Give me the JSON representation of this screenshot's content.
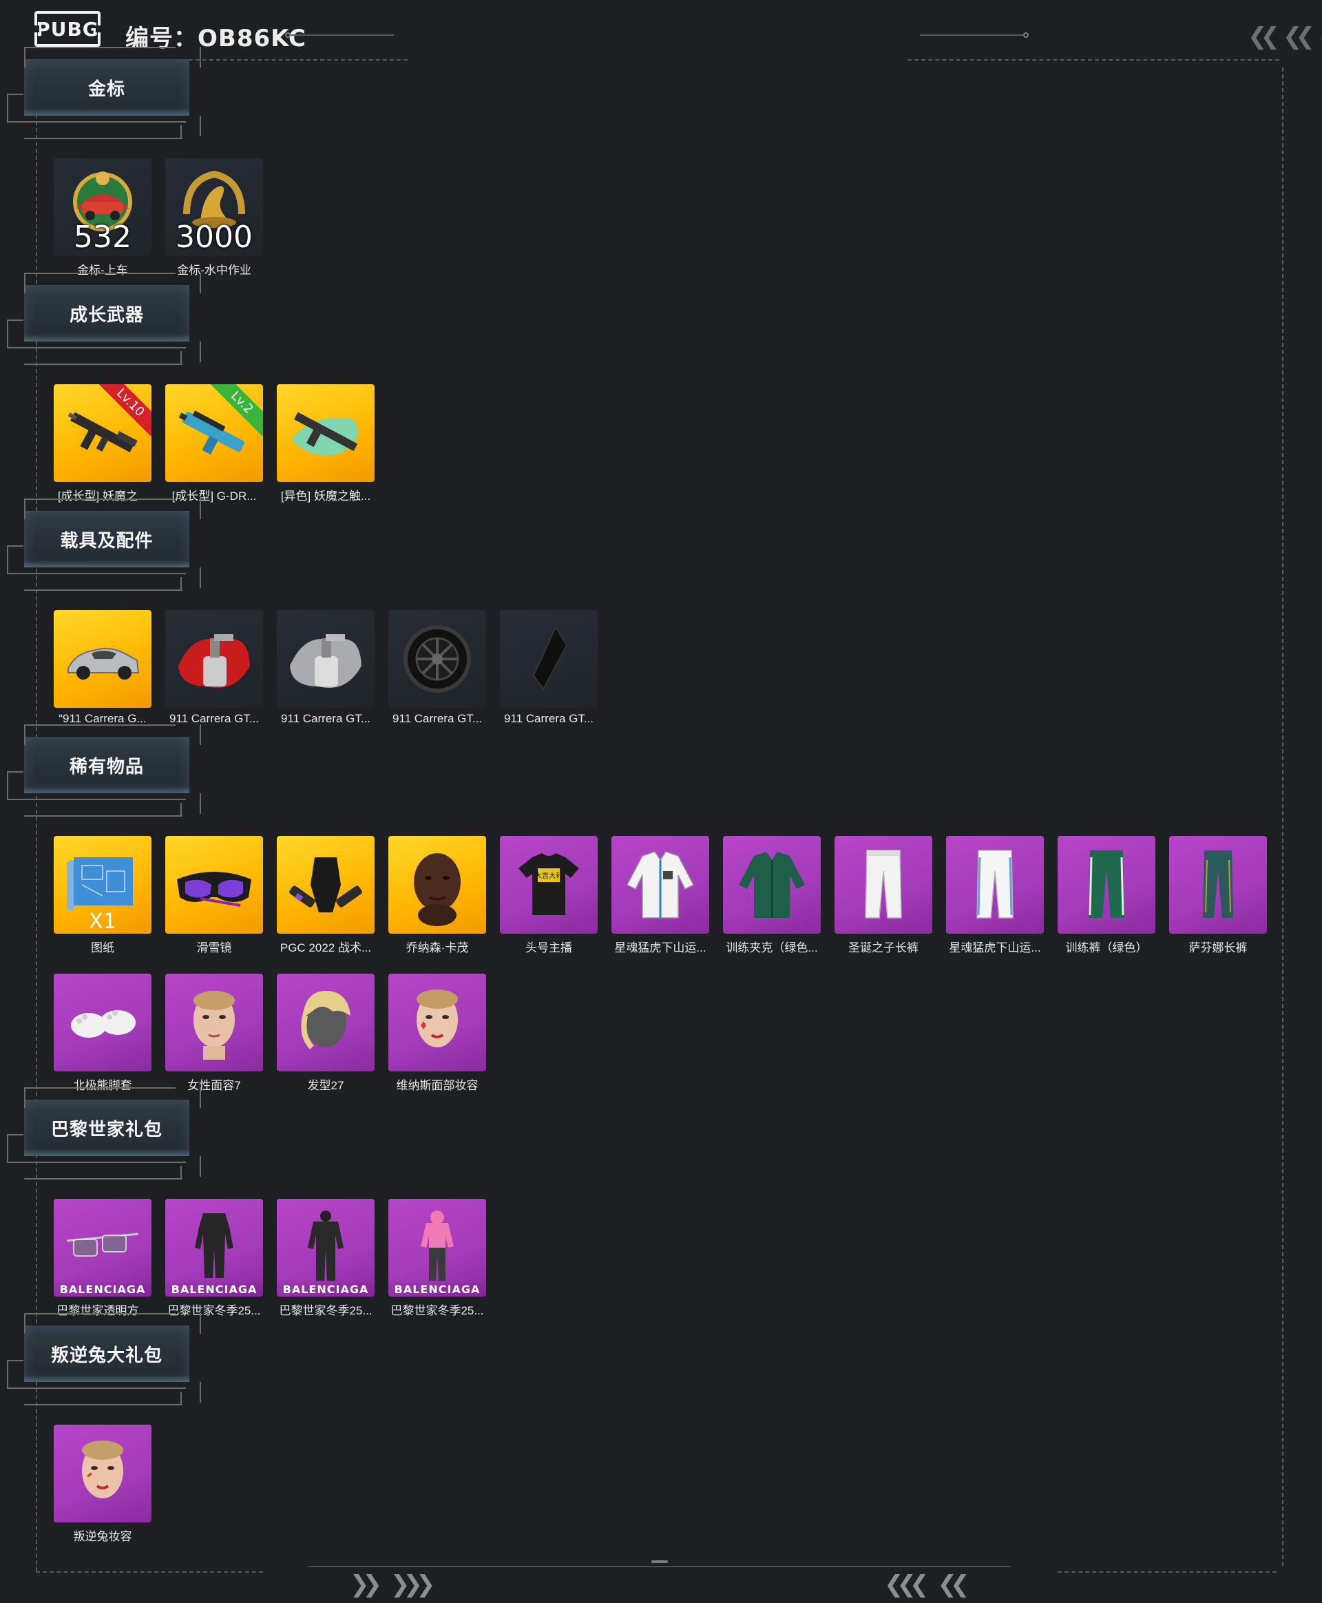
{
  "header": {
    "logo_text": "PUBG",
    "serial_label": "编号：",
    "serial_value": "OB86KC"
  },
  "sections": [
    {
      "title": "金标",
      "items": [
        {
          "label": "金标-上车",
          "tile": "dark",
          "icon": "gold-car-emblem-icon",
          "quantity": "532"
        },
        {
          "label": "金标-水中作业",
          "tile": "dark",
          "icon": "gold-seal-emblem-icon",
          "quantity": "3000"
        }
      ]
    },
    {
      "title": "成长武器",
      "items": [
        {
          "label": "[成长型] 妖魔之...",
          "tile": "gold",
          "icon": "assault-rifle-icon",
          "ribbon": "Lv.10",
          "ribbon_color": "#d82027"
        },
        {
          "label": "[成长型] G-DR...",
          "tile": "gold",
          "icon": "blue-rifle-icon",
          "ribbon": "Lv.2",
          "ribbon_color": "#39b53a"
        },
        {
          "label": "[异色] 妖魔之触...",
          "tile": "gold",
          "icon": "rifle-splash-icon"
        }
      ]
    },
    {
      "title": "载具及配件",
      "items": [
        {
          "label": "“911 Carrera G...",
          "tile": "gold",
          "icon": "sports-car-icon"
        },
        {
          "label": "911 Carrera GT...",
          "tile": "dark",
          "icon": "red-paint-spray-icon"
        },
        {
          "label": "911 Carrera GT...",
          "tile": "dark",
          "icon": "silver-paint-spray-icon"
        },
        {
          "label": "911 Carrera GT...",
          "tile": "dark",
          "icon": "wheel-rim-icon"
        },
        {
          "label": "911 Carrera GT...",
          "tile": "dark",
          "icon": "black-shard-icon"
        }
      ]
    },
    {
      "title": "稀有物品",
      "items": [
        {
          "label": "图纸",
          "tile": "gold",
          "icon": "blueprint-icon",
          "quantity_small": "X1"
        },
        {
          "label": "滑雪镜",
          "tile": "gold",
          "icon": "ski-goggles-icon"
        },
        {
          "label": "PGC 2022 战术...",
          "tile": "gold",
          "icon": "tactical-gear-icon"
        },
        {
          "label": "乔纳森·卡茂",
          "tile": "gold",
          "icon": "male-head-icon"
        },
        {
          "label": "头号主播",
          "tile": "purple",
          "icon": "tshirt-icon"
        },
        {
          "label": "星魂猛虎下山运...",
          "tile": "purple",
          "icon": "white-jacket-icon"
        },
        {
          "label": "训练夹克（绿色...",
          "tile": "purple",
          "icon": "green-jacket-icon"
        },
        {
          "label": "圣诞之子长裤",
          "tile": "purple",
          "icon": "white-pants-icon"
        },
        {
          "label": "星魂猛虎下山运...",
          "tile": "purple",
          "icon": "white-track-pants-icon"
        },
        {
          "label": "训练裤（绿色）",
          "tile": "purple",
          "icon": "green-pants-icon"
        },
        {
          "label": "萨芬娜长裤",
          "tile": "purple",
          "icon": "teal-pants-icon"
        }
      ],
      "items_row2": [
        {
          "label": "北极熊脚套",
          "tile": "purple",
          "icon": "bear-paws-icon"
        },
        {
          "label": "女性面容7",
          "tile": "purple",
          "icon": "female-face-icon"
        },
        {
          "label": "发型27",
          "tile": "purple",
          "icon": "hairstyle-icon"
        },
        {
          "label": "维纳斯面部妆容",
          "tile": "purple",
          "icon": "makeup-face-icon"
        }
      ]
    },
    {
      "title": "巴黎世家礼包",
      "items": [
        {
          "label": "巴黎世家透明方...",
          "tile": "purple",
          "icon": "sunglasses-icon",
          "badge": "BALENCIAGA"
        },
        {
          "label": "巴黎世家冬季25...",
          "tile": "purple",
          "icon": "black-outfit-icon",
          "badge": "BALENCIAGA"
        },
        {
          "label": "巴黎世家冬季25...",
          "tile": "purple",
          "icon": "black-suit-icon",
          "badge": "BALENCIAGA"
        },
        {
          "label": "巴黎世家冬季25...",
          "tile": "purple",
          "icon": "pink-hoodie-outfit-icon",
          "badge": "BALENCIAGA"
        }
      ]
    },
    {
      "title": "叛逆兔大礼包",
      "items": [
        {
          "label": "叛逆兔妆容",
          "tile": "purple",
          "icon": "rebel-makeup-face-icon"
        }
      ]
    }
  ],
  "colors": {
    "background": "#1e1f22",
    "gold_tile": "#ffb500",
    "purple_tile": "#a43bb9",
    "dark_tile": "#1f242b"
  }
}
